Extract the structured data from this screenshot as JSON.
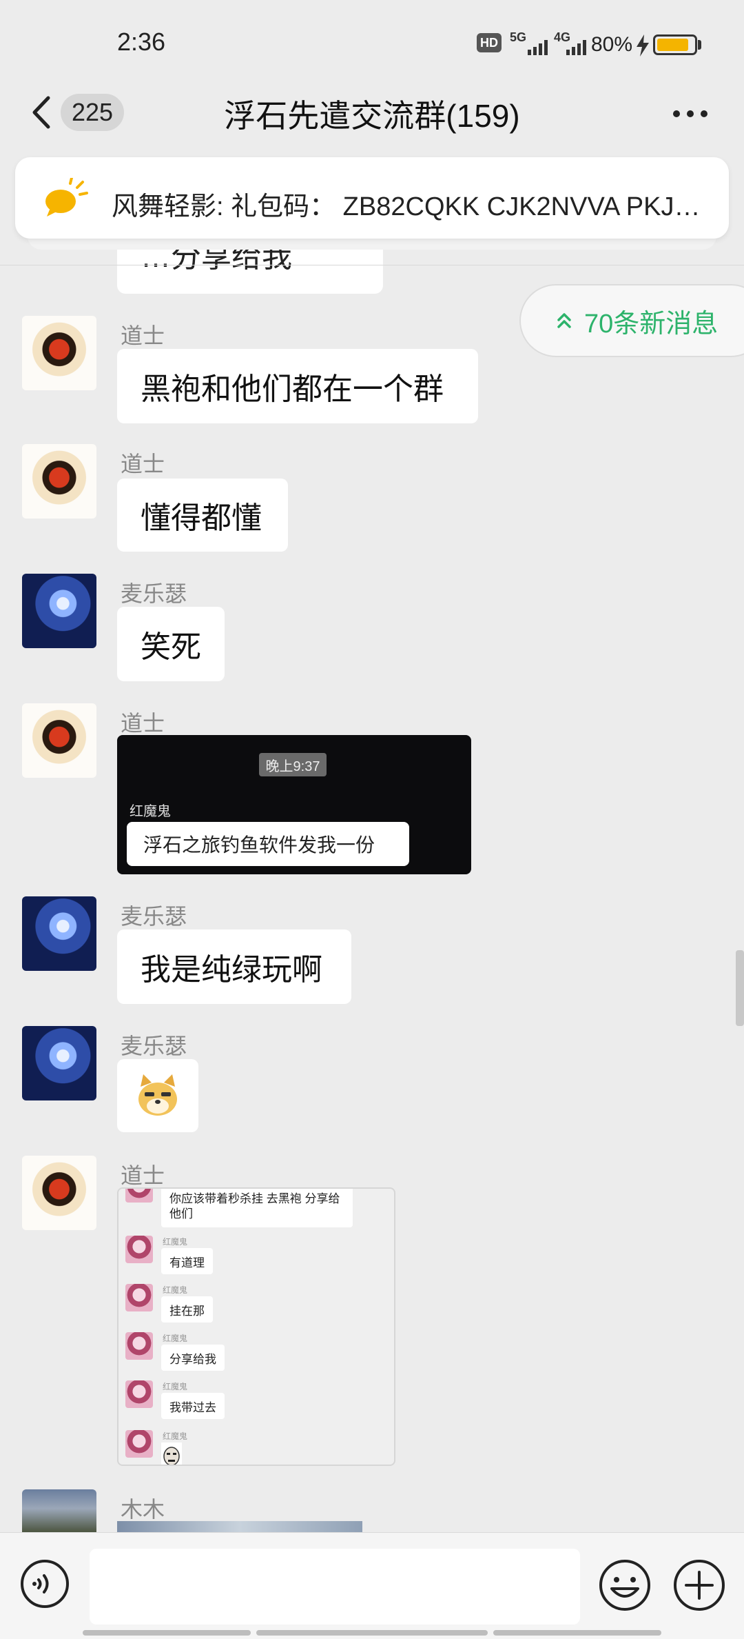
{
  "status_bar": {
    "time": "2:36",
    "hd_label": "HD",
    "network_5g": "5G",
    "network_4g": "4G",
    "battery_pct": "80%"
  },
  "header": {
    "unread_count": "225",
    "title": "浮石先遣交流群(159)"
  },
  "announcement": {
    "text": "风舞轻影: 礼包码：  ZB82CQKK CJK2NVVA PKJC..."
  },
  "partial_message": "…分享给我",
  "new_messages": {
    "label": "70条新消息"
  },
  "messages": [
    {
      "sender": "道士",
      "text": "黑袍和他们都在一个群"
    },
    {
      "sender": "道士",
      "text": "懂得都懂"
    },
    {
      "sender": "麦乐瑟",
      "text": "笑死"
    },
    {
      "sender": "道士",
      "image": {
        "time": "晚上9:37",
        "inner_sender": "红魔鬼",
        "inner_text": "浮石之旅钓鱼软件发我一份"
      }
    },
    {
      "sender": "麦乐瑟",
      "text": "我是纯绿玩啊"
    },
    {
      "sender": "麦乐瑟",
      "emoji": "doge"
    },
    {
      "sender": "道士",
      "record": {
        "top_text": "你应该带着秒杀挂 去黑袍 分享给他们",
        "items": [
          {
            "name": "红魔鬼",
            "text": "有道理"
          },
          {
            "name": "红魔鬼",
            "text": "挂在那"
          },
          {
            "name": "红魔鬼",
            "text": "分享给我"
          },
          {
            "name": "红魔鬼",
            "text": "我带过去"
          },
          {
            "name": "红魔鬼",
            "text": ""
          }
        ]
      }
    },
    {
      "sender": "木木"
    }
  ],
  "input": {
    "placeholder": ""
  },
  "colors": {
    "background": "#ececec",
    "accent_green": "#2db36b",
    "bubble": "#ffffff",
    "announce_icon": "#f6b400"
  }
}
